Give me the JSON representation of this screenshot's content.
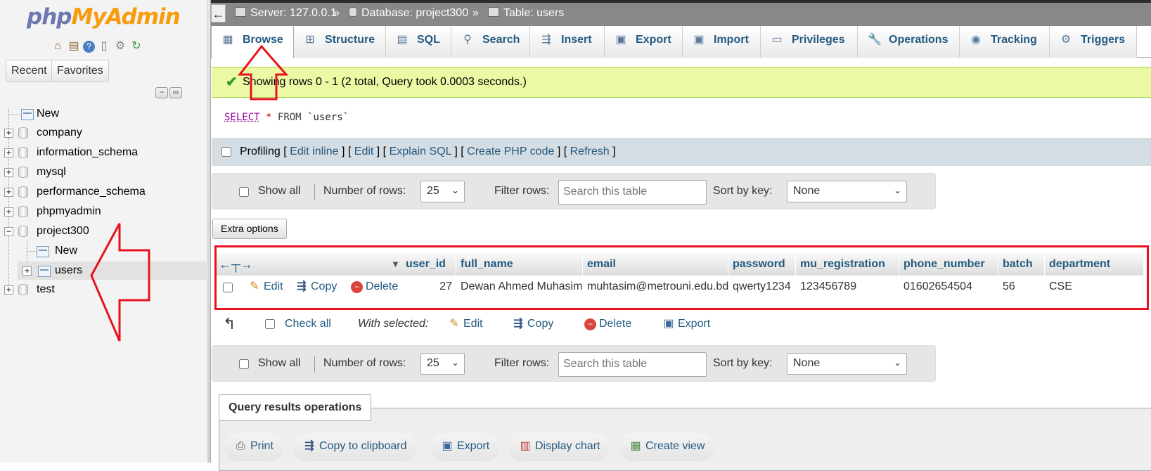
{
  "nav": {
    "logo_part1": "php",
    "logo_part2": "MyAdmin",
    "icons": [
      "home-icon",
      "database-icon",
      "help-icon",
      "docs-icon",
      "settings-icon",
      "reload-icon"
    ],
    "recent_label": "Recent",
    "favorites_label": "Favorites",
    "tree": [
      {
        "label": "New",
        "expandable": false
      },
      {
        "label": "company",
        "expandable": true
      },
      {
        "label": "information_schema",
        "expandable": true
      },
      {
        "label": "mysql",
        "expandable": true
      },
      {
        "label": "performance_schema",
        "expandable": true
      },
      {
        "label": "phpmyadmin",
        "expandable": true
      },
      {
        "label": "project300",
        "expandable": true,
        "expanded": true
      },
      {
        "label": "New",
        "expandable": false
      },
      {
        "label": "users",
        "expandable": true,
        "selected": true
      },
      {
        "label": "test",
        "expandable": true
      }
    ]
  },
  "breadcrumb": {
    "server": "Server: 127.0.0.1",
    "database": "Database: project300",
    "table": "Table: users",
    "sep": "»"
  },
  "tabs": [
    {
      "label": "Browse",
      "icon": "browse-icon",
      "active": true
    },
    {
      "label": "Structure",
      "icon": "structure-icon"
    },
    {
      "label": "SQL",
      "icon": "sql-icon"
    },
    {
      "label": "Search",
      "icon": "search-icon"
    },
    {
      "label": "Insert",
      "icon": "insert-icon"
    },
    {
      "label": "Export",
      "icon": "export-icon"
    },
    {
      "label": "Import",
      "icon": "import-icon"
    },
    {
      "label": "Privileges",
      "icon": "privileges-icon"
    },
    {
      "label": "Operations",
      "icon": "wrench-icon"
    },
    {
      "label": "Tracking",
      "icon": "eye-icon"
    },
    {
      "label": "Triggers",
      "icon": "triggers-icon"
    }
  ],
  "message": "Showing rows 0 - 1 (2 total, Query took 0.0003 seconds.)",
  "sql": {
    "select": "SELECT",
    "star": "*",
    "from": "FROM",
    "table": "`users`"
  },
  "profiling": {
    "label": "Profiling",
    "links": [
      "Edit inline",
      "Edit",
      "Explain SQL",
      "Create PHP code",
      "Refresh"
    ]
  },
  "nav_controls": {
    "show_all": "Show all",
    "rows_label": "Number of rows:",
    "rows_value": "25",
    "filter_label": "Filter rows:",
    "filter_placeholder": "Search this table",
    "sort_label": "Sort by key:",
    "sort_value": "None"
  },
  "extra_options": "Extra options",
  "table": {
    "columns": [
      "user_id",
      "full_name",
      "email",
      "password",
      "mu_registration",
      "phone_number",
      "batch",
      "department"
    ],
    "rows": [
      {
        "actions": [
          "Edit",
          "Copy",
          "Delete"
        ],
        "cells": [
          "27",
          "Dewan Ahmed Muhasim",
          "muhtasim@metrouni.edu.bd",
          "qwerty1234",
          "123456789",
          "01602654504",
          "56",
          "CSE"
        ]
      }
    ]
  },
  "bulk": {
    "check_all": "Check all",
    "with_selected": "With selected:",
    "edit": "Edit",
    "copy": "Copy",
    "delete": "Delete",
    "export": "Export"
  },
  "query_ops": {
    "legend": "Query results operations",
    "print": "Print",
    "copy_clipboard": "Copy to clipboard",
    "export": "Export",
    "display_chart": "Display chart",
    "create_view": "Create view"
  },
  "colors": {
    "link": "#235a81",
    "annotation": "#e8121f",
    "success_bg": "#ebf8a4"
  }
}
